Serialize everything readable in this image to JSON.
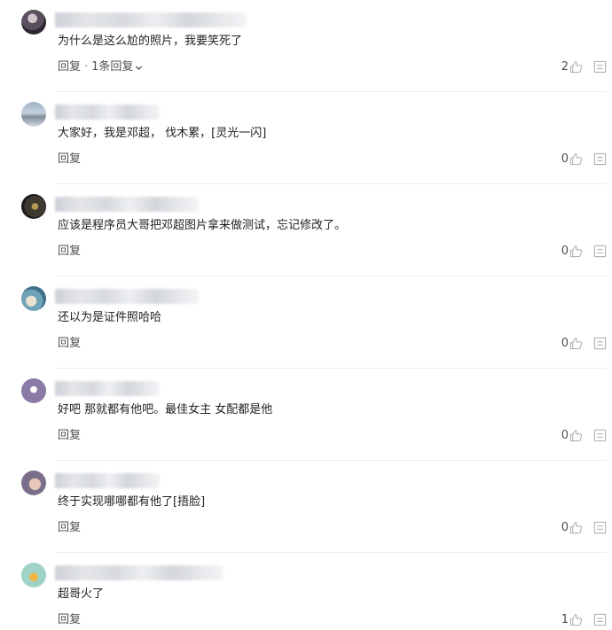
{
  "comments": [
    {
      "text": "为什么是这么尬的照片，我要笑死了",
      "reply_label": "回复",
      "sep": "·",
      "more_replies": "1条回复",
      "likes": "2"
    },
    {
      "text": "大家好，我是邓超， 伐木累，[灵光一闪]",
      "reply_label": "回复",
      "likes": "0"
    },
    {
      "text": "应该是程序员大哥把邓超图片拿来做测试，忘记修改了。",
      "reply_label": "回复",
      "likes": "0"
    },
    {
      "text": "还以为是证件照哈哈",
      "reply_label": "回复",
      "likes": "0"
    },
    {
      "text": "好吧 那就都有他吧。最佳女主 女配都是他",
      "reply_label": "回复",
      "likes": "0"
    },
    {
      "text": "终于实现哪哪都有他了[捂脸]",
      "reply_label": "回复",
      "likes": "0"
    },
    {
      "text": "超哥火了",
      "reply_label": "回复",
      "likes": "1"
    }
  ],
  "icons": {
    "like": "thumbs-up-icon",
    "more": "more-icon",
    "expand": "chevron-down-icon"
  },
  "colors": {
    "text": "#222222",
    "meta": "#505050",
    "divider": "#ededed",
    "icon": "#b4b4b4"
  }
}
